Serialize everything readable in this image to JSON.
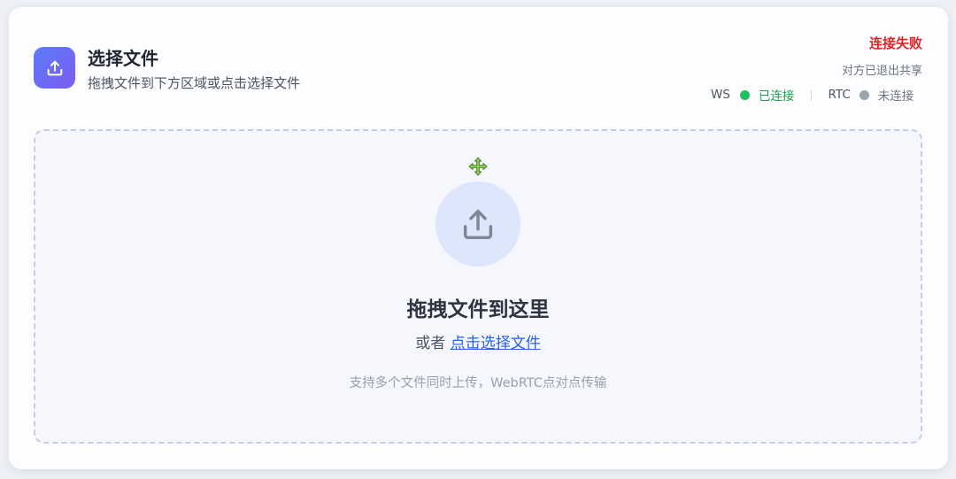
{
  "header": {
    "title": "选择文件",
    "subtitle": "拖拽文件到下方区域或点击选择文件",
    "icon": "upload-icon"
  },
  "status": {
    "title": "连接失败",
    "detail": "对方已退出共享",
    "ws_label": "WS",
    "ws_state": "已连接",
    "ws_color": "#1fbf5c",
    "rtc_label": "RTC",
    "rtc_state": "未连接",
    "rtc_color": "#9ca3af",
    "separator": "|"
  },
  "dropzone": {
    "title": "拖拽文件到这里",
    "or_text": "或者",
    "link_text": "点击选择文件",
    "hint": "支持多个文件同时上传，WebRTC点对点传输",
    "icon": "upload-icon",
    "cursor_icon": "move-cursor-icon"
  },
  "colors": {
    "accent": "#5b7cfa",
    "error": "#e02424",
    "success": "#1aa14e",
    "link": "#2563eb"
  }
}
